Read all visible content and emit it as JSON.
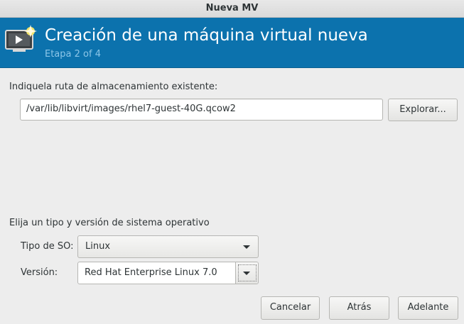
{
  "window": {
    "title": "Nueva MV"
  },
  "header": {
    "title": "Creación de una máquina virtual nueva",
    "step": "Etapa 2 of 4",
    "icon": "vm-screen-new-icon"
  },
  "storage": {
    "label": "Indiquela ruta de almacenamiento existente:",
    "path_value": "/var/lib/libvirt/images/rhel7-guest-40G.qcow2",
    "browse_label": "Explorar..."
  },
  "os": {
    "section_label": "Elija un tipo y versión de sistema operativo",
    "type_label": "Tipo de SO:",
    "type_value": "Linux",
    "version_label": "Versión:",
    "version_value": "Red Hat Enterprise Linux 7.0"
  },
  "footer": {
    "cancel_label": "Cancelar",
    "back_label": "Atrás",
    "forward_label": "Adelante"
  },
  "colors": {
    "header_bg": "#0c72ad",
    "header_subtitle": "#8cc6e8",
    "window_bg": "#ededed"
  }
}
